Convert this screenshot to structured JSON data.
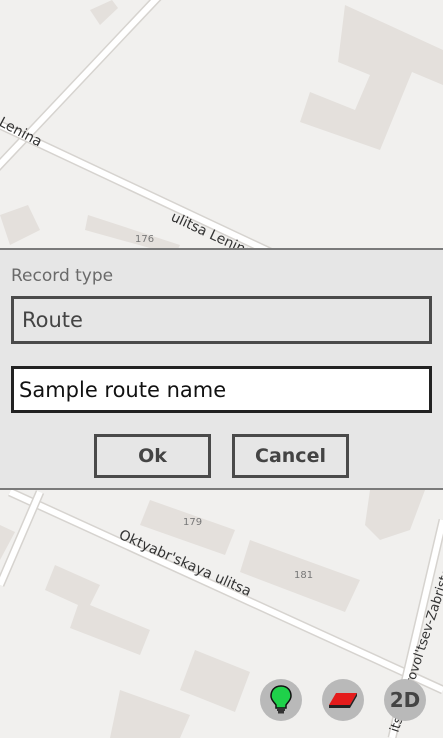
{
  "map": {
    "labels": {
      "street_lenina_left": "Lenina",
      "street_lenina_main": "ulitsa Lenina",
      "street_oktyabrskaya": "Oktyabr'skaya ulitsa",
      "street_right": "its. Dobrovol'tsev-Zabristov",
      "house_176": "176",
      "house_179": "179",
      "house_181": "181"
    }
  },
  "dialog": {
    "record_type_label": "Record type",
    "record_type_value": "Route",
    "name_value": "Sample route name",
    "ok_label": "Ok",
    "cancel_label": "Cancel"
  },
  "controls": {
    "bulb_icon": "lightbulb-icon",
    "layer_icon": "layer-icon",
    "view_mode_label": "2D"
  },
  "colors": {
    "map_background": "#f1f0ee",
    "building": "#e4e0dc",
    "road": "#ffffff",
    "dialog_background": "#e6e6e6",
    "bulb": "#1fd14a",
    "layer": "#e41b1b"
  }
}
